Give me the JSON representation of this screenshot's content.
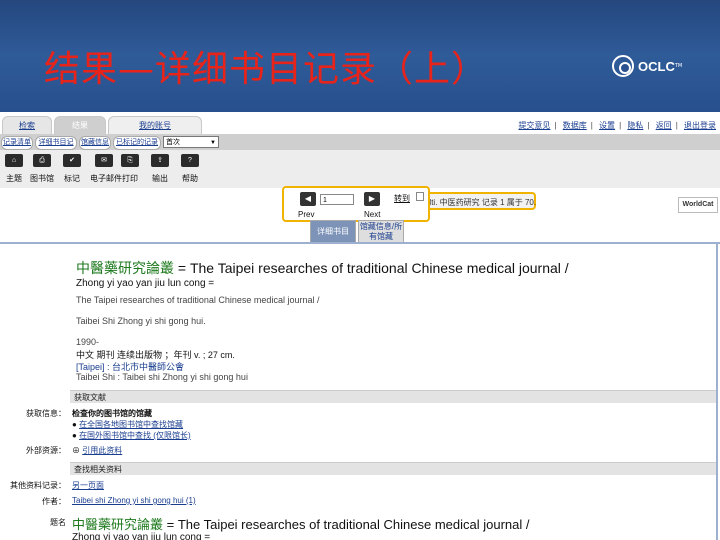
{
  "slide": {
    "title": "结果—详细书目记录（上）",
    "logo_text": "OCLC",
    "logo_tm": "TM"
  },
  "tabs": [
    {
      "label": "检索"
    },
    {
      "label": "结果"
    },
    {
      "label": "我的账号"
    }
  ],
  "top_links": [
    "提交意见",
    "数据库",
    "设置",
    "隐私",
    "返回",
    "退出登录"
  ],
  "subnav": {
    "items": [
      "记录清单",
      "详细书目记录",
      "馆藏信息",
      "已标记的记录"
    ],
    "select_value": "首次"
  },
  "toolbar": [
    {
      "icon": "home-icon",
      "glyph": "⌂",
      "label": "主题"
    },
    {
      "icon": "print-icon",
      "glyph": "⎙",
      "label": "图书馆"
    },
    {
      "icon": "mark-icon",
      "glyph": "✔",
      "label": "标记"
    },
    {
      "icon": "email-icon",
      "glyph": "✉",
      "label": "电子邮件"
    },
    {
      "icon": "save-icon",
      "glyph": "⎘",
      "label": "打印"
    },
    {
      "icon": "export-icon",
      "glyph": "⇪",
      "label": "输出"
    },
    {
      "icon": "help-icon",
      "glyph": "?",
      "label": "帮助"
    }
  ],
  "status_text": "WorldCat 检索的是，lti. 中医药研究 记录 1 属于 70.",
  "worldcat_logo": "WorldCat",
  "pager": {
    "page_value": "1",
    "go_label": "转到",
    "prev_label": "Prev",
    "next_label": "Next"
  },
  "record_tabs": [
    {
      "label": "详细书目",
      "active": true
    },
    {
      "label": "馆藏信息/所有馆藏",
      "active": false
    }
  ],
  "record": {
    "title_cn": "中醫藥研究論叢",
    "title_en": " = The Taipei researches of traditional Chinese medical journal /",
    "romanized": "Zhong yi yao yan jiu lun cong =",
    "alt_title": "The Taipei researches of traditional Chinese medical journal /",
    "author": "Taibei Shi Zhong yi shi gong hui.",
    "date": "1990-",
    "format": "中文 期刊 连续出版物 ；年刊 v. ; 27 cm.",
    "publisher_cn": "[Taipei] : 台北市中醫師公會",
    "publisher_en": "Taibei Shi : Taibei shi Zhong yi shi gong hui"
  },
  "sections": {
    "get_doc": "获取文献",
    "find_related": "查找相关资料"
  },
  "labels": {
    "search_info": "获取信息：",
    "external": "外部资源：",
    "other_records": "其他资料记录：",
    "author": "作者：",
    "title2": "题名"
  },
  "items": {
    "search_info_text": "检查你的图书馆的馆藏",
    "search_info_1": "在全国各地图书馆中查找馆藏",
    "search_info_2": "在国外图书馆中查找 (仅限馆长)",
    "external_link": "引用此资料",
    "other_records_link": "另一页面",
    "author_link": "Taibei shi Zhong yi shi gong hui (1)"
  },
  "record2": {
    "title_cn": "中醫藥研究論叢",
    "title_en": " = The Taipei researches of traditional Chinese medical journal /",
    "romanized": "Zhong yi yao yan jiu lun cong ="
  }
}
